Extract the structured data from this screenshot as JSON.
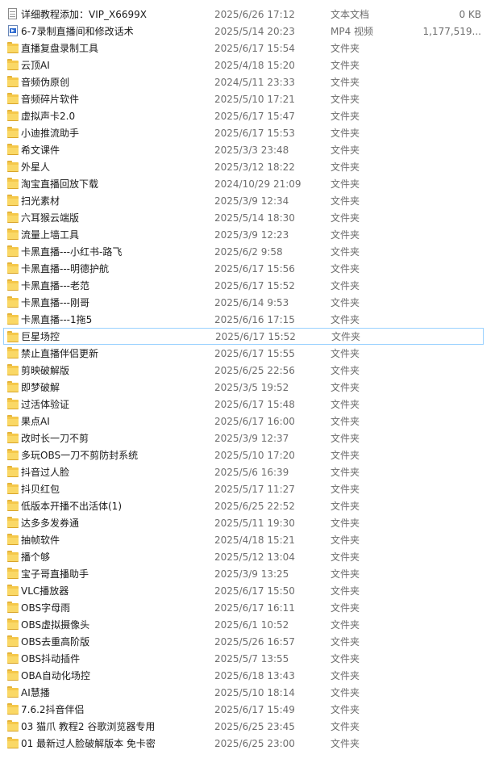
{
  "files": [
    {
      "name": "详细教程添加：VIP_X6699X",
      "date": "2025/6/26 17:12",
      "type": "文本文档",
      "size": "0 KB",
      "icon": "text-file-icon"
    },
    {
      "name": "6-7录制直播间和修改话术",
      "date": "2025/5/14 20:23",
      "type": "MP4 视频",
      "size": "1,177,519...",
      "icon": "video-file-icon"
    },
    {
      "name": "直播复盘录制工具",
      "date": "2025/6/17 15:54",
      "type": "文件夹",
      "size": "",
      "icon": "folder-icon"
    },
    {
      "name": "云顶AI",
      "date": "2025/4/18 15:20",
      "type": "文件夹",
      "size": "",
      "icon": "folder-icon"
    },
    {
      "name": "音频伪原创",
      "date": "2024/5/11 23:33",
      "type": "文件夹",
      "size": "",
      "icon": "folder-icon"
    },
    {
      "name": "音频碎片软件",
      "date": "2025/5/10 17:21",
      "type": "文件夹",
      "size": "",
      "icon": "folder-icon"
    },
    {
      "name": "虚拟声卡2.0",
      "date": "2025/6/17 15:47",
      "type": "文件夹",
      "size": "",
      "icon": "folder-icon"
    },
    {
      "name": "小迪推流助手",
      "date": "2025/6/17 15:53",
      "type": "文件夹",
      "size": "",
      "icon": "folder-icon"
    },
    {
      "name": "希文课件",
      "date": "2025/3/3 23:48",
      "type": "文件夹",
      "size": "",
      "icon": "folder-icon"
    },
    {
      "name": "外星人",
      "date": "2025/3/12 18:22",
      "type": "文件夹",
      "size": "",
      "icon": "folder-icon"
    },
    {
      "name": "淘宝直播回放下载",
      "date": "2024/10/29 21:09",
      "type": "文件夹",
      "size": "",
      "icon": "folder-icon"
    },
    {
      "name": "扫光素材",
      "date": "2025/3/9 12:34",
      "type": "文件夹",
      "size": "",
      "icon": "folder-icon"
    },
    {
      "name": "六耳猴云端版",
      "date": "2025/5/14 18:30",
      "type": "文件夹",
      "size": "",
      "icon": "folder-icon"
    },
    {
      "name": "流量上墙工具",
      "date": "2025/3/9 12:23",
      "type": "文件夹",
      "size": "",
      "icon": "folder-icon"
    },
    {
      "name": "卡黑直播---小红书-路飞",
      "date": "2025/6/2 9:58",
      "type": "文件夹",
      "size": "",
      "icon": "folder-icon"
    },
    {
      "name": "卡黑直播---明德护航",
      "date": "2025/6/17 15:56",
      "type": "文件夹",
      "size": "",
      "icon": "folder-icon"
    },
    {
      "name": "卡黑直播---老范",
      "date": "2025/6/17 15:52",
      "type": "文件夹",
      "size": "",
      "icon": "folder-icon"
    },
    {
      "name": "卡黑直播---刚哥",
      "date": "2025/6/14 9:53",
      "type": "文件夹",
      "size": "",
      "icon": "folder-icon"
    },
    {
      "name": "卡黑直播---1拖5",
      "date": "2025/6/16 17:15",
      "type": "文件夹",
      "size": "",
      "icon": "folder-icon"
    },
    {
      "name": "巨星场控",
      "date": "2025/6/17 15:52",
      "type": "文件夹",
      "size": "",
      "icon": "folder-icon",
      "selected": true
    },
    {
      "name": "禁止直播伴侣更新",
      "date": "2025/6/17 15:55",
      "type": "文件夹",
      "size": "",
      "icon": "folder-icon"
    },
    {
      "name": "剪映破解版",
      "date": "2025/6/25 22:56",
      "type": "文件夹",
      "size": "",
      "icon": "folder-icon"
    },
    {
      "name": "即梦破解",
      "date": "2025/3/5 19:52",
      "type": "文件夹",
      "size": "",
      "icon": "folder-icon"
    },
    {
      "name": "过活体验证",
      "date": "2025/6/17 15:48",
      "type": "文件夹",
      "size": "",
      "icon": "folder-icon"
    },
    {
      "name": "果点AI",
      "date": "2025/6/17 16:00",
      "type": "文件夹",
      "size": "",
      "icon": "folder-icon"
    },
    {
      "name": "改时长一刀不剪",
      "date": "2025/3/9 12:37",
      "type": "文件夹",
      "size": "",
      "icon": "folder-icon"
    },
    {
      "name": "多玩OBS一刀不剪防封系统",
      "date": "2025/5/10 17:20",
      "type": "文件夹",
      "size": "",
      "icon": "folder-icon"
    },
    {
      "name": "抖音过人脸",
      "date": "2025/5/6 16:39",
      "type": "文件夹",
      "size": "",
      "icon": "folder-icon"
    },
    {
      "name": "抖贝红包",
      "date": "2025/5/17 11:27",
      "type": "文件夹",
      "size": "",
      "icon": "folder-icon"
    },
    {
      "name": "低版本开播不出活体(1)",
      "date": "2025/6/25 22:52",
      "type": "文件夹",
      "size": "",
      "icon": "folder-icon"
    },
    {
      "name": "达多多发券通",
      "date": "2025/5/11 19:30",
      "type": "文件夹",
      "size": "",
      "icon": "folder-icon"
    },
    {
      "name": "抽帧软件",
      "date": "2025/4/18 15:21",
      "type": "文件夹",
      "size": "",
      "icon": "folder-icon"
    },
    {
      "name": "播个够",
      "date": "2025/5/12 13:04",
      "type": "文件夹",
      "size": "",
      "icon": "folder-icon"
    },
    {
      "name": "宝子哥直播助手",
      "date": "2025/3/9 13:25",
      "type": "文件夹",
      "size": "",
      "icon": "folder-icon"
    },
    {
      "name": "VLC播放器",
      "date": "2025/6/17 15:50",
      "type": "文件夹",
      "size": "",
      "icon": "folder-icon"
    },
    {
      "name": "OBS字母雨",
      "date": "2025/6/17 16:11",
      "type": "文件夹",
      "size": "",
      "icon": "folder-icon"
    },
    {
      "name": "OBS虚拟摄像头",
      "date": "2025/6/1 10:52",
      "type": "文件夹",
      "size": "",
      "icon": "folder-icon"
    },
    {
      "name": "OBS去重高阶版",
      "date": "2025/5/26 16:57",
      "type": "文件夹",
      "size": "",
      "icon": "folder-icon"
    },
    {
      "name": "OBS抖动插件",
      "date": "2025/5/7 13:55",
      "type": "文件夹",
      "size": "",
      "icon": "folder-icon"
    },
    {
      "name": "OBA自动化场控",
      "date": "2025/6/18 13:43",
      "type": "文件夹",
      "size": "",
      "icon": "folder-icon"
    },
    {
      "name": "AI慧播",
      "date": "2025/5/10 18:14",
      "type": "文件夹",
      "size": "",
      "icon": "folder-icon"
    },
    {
      "name": "7.6.2抖音伴侣",
      "date": "2025/6/17 15:49",
      "type": "文件夹",
      "size": "",
      "icon": "folder-icon"
    },
    {
      "name": "03 猫爪 教程2 谷歌浏览器专用",
      "date": "2025/6/25 23:45",
      "type": "文件夹",
      "size": "",
      "icon": "folder-icon"
    },
    {
      "name": "01 最新过人脸破解版本 免卡密",
      "date": "2025/6/25 23:00",
      "type": "文件夹",
      "size": "",
      "icon": "folder-icon"
    }
  ]
}
